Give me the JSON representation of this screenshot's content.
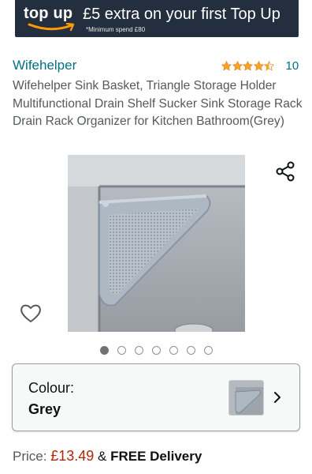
{
  "banner": {
    "logo_text": "top up",
    "headline": "£5 extra on your first Top Up",
    "fineprint": "*Minimum spend £80",
    "colors": {
      "background": "#232f3e",
      "smile": "#ff9900"
    }
  },
  "product": {
    "brand": "Wifehelper",
    "rating": {
      "stars": 4.5,
      "max": 5,
      "count": "10"
    },
    "title": "Wifehelper Sink Basket, Triangle Storage Holder Multifunctional Drain Shelf Sucker Sink Storage Rack Drain Rack Organizer for Kitchen Bathroom(Grey)",
    "image_carousel": {
      "total": 7,
      "active_index": 0
    },
    "icons": {
      "share": "share-icon",
      "wishlist": "heart-icon"
    }
  },
  "variation": {
    "label": "Colour:",
    "value": "Grey",
    "icon": "chevron-right-icon"
  },
  "price": {
    "label": "Price:",
    "amount": "£13.49",
    "separator": "&",
    "delivery": "FREE Delivery",
    "colors": {
      "price": "#b12704",
      "link": "#007185",
      "star": "#ffa41c"
    }
  }
}
